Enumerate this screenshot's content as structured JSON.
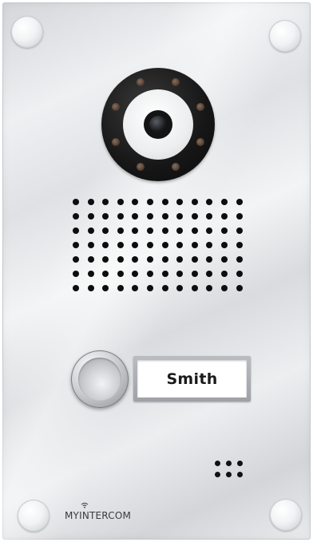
{
  "image_description": "",
  "nameplate": {
    "label": "Smith"
  },
  "brand": {
    "logo_text": "MYINTERCOM"
  },
  "colors": {
    "panel": "#e6e8ea",
    "camera_ring": "#141414",
    "speaker_holes": "#0d0d0d",
    "nameplate_text": "#1a1a1a"
  },
  "icons": {
    "camera": "camera-lens-icon",
    "bell": "doorbell-button-icon",
    "logo_wifi": "wifi-icon"
  },
  "speaker_grille": {
    "rows": 7,
    "columns": 12
  },
  "microphone_holes": {
    "rows": 2,
    "columns": 3
  },
  "camera_leds": 8
}
